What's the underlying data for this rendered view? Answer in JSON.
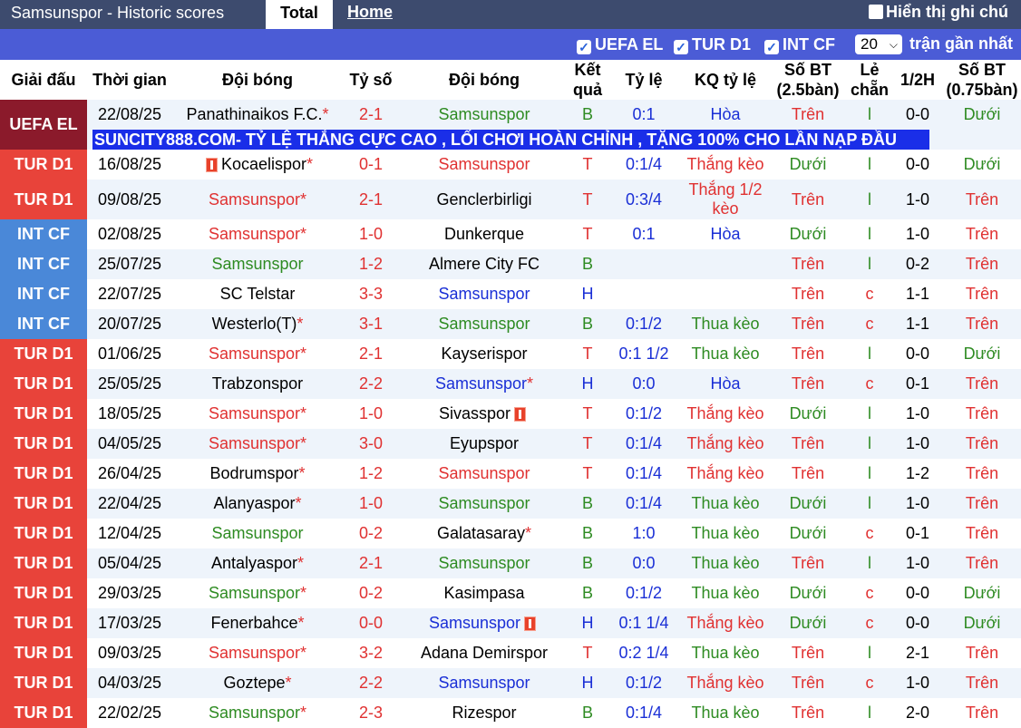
{
  "top": {
    "title": "Samsunspor - Historic scores",
    "tab_total": "Total",
    "tab_home": "Home",
    "note_label": "Hiển thị ghi chú"
  },
  "filters": {
    "items": [
      "UEFA EL",
      "TUR D1",
      "INT CF"
    ],
    "count_value": "20",
    "count_suffix": "trận gần nhất"
  },
  "columns": [
    "Giải đấu",
    "Thời gian",
    "Đội bóng",
    "Tỷ số",
    "Đội bóng",
    "Kết quả",
    "Tỷ lệ",
    "KQ tỷ lệ",
    "Số BT (2.5bàn)",
    "Lẻ chẵn",
    "1/2H",
    "Số BT (0.75bàn)"
  ],
  "banner": "SUNCITY888.COM- TỶ LỆ THẮNG CỰC CAO , LỐI CHƠI HOÀN CHỈNH , TẶNG 100% CHO LẦN NẠP ĐẦU",
  "colors": {
    "uefa": "#8b1a2b",
    "tur": "#e8433a",
    "int": "#4a88d8",
    "red": "#e03131",
    "green": "#2e8b22",
    "blue": "#1a2fd6"
  },
  "rows": [
    {
      "comp": "UEFA EL",
      "date": "22/08/25",
      "home": "Panathinaikos F.C.",
      "home_star": true,
      "home_color": "black",
      "home_card": false,
      "score": "2-1",
      "away": "Samsunspor",
      "away_star": false,
      "away_color": "green",
      "away_card": false,
      "res": "B",
      "odds": "0:1",
      "kq": "Hòa",
      "ou": "Trên",
      "oe": "l",
      "ht": "0-0",
      "ou2": "Dưới"
    },
    {
      "comp": "TUR D1",
      "date": "16/08/25",
      "home": "Kocaelispor",
      "home_star": true,
      "home_color": "black",
      "home_card": true,
      "score": "0-1",
      "away": "Samsunspor",
      "away_star": false,
      "away_color": "red",
      "away_card": false,
      "res": "T",
      "odds": "0:1/4",
      "kq": "Thắng kèo",
      "ou": "Dưới",
      "oe": "l",
      "ht": "0-0",
      "ou2": "Dưới"
    },
    {
      "comp": "TUR D1",
      "date": "09/08/25",
      "home": "Samsunspor",
      "home_star": true,
      "home_color": "red",
      "home_card": false,
      "score": "2-1",
      "away": "Genclerbirligi",
      "away_star": false,
      "away_color": "black",
      "away_card": false,
      "res": "T",
      "odds": "0:3/4",
      "kq": "Thắng 1/2 kèo",
      "ou": "Trên",
      "oe": "l",
      "ht": "1-0",
      "ou2": "Trên"
    },
    {
      "comp": "INT CF",
      "date": "02/08/25",
      "home": "Samsunspor",
      "home_star": true,
      "home_color": "red",
      "home_card": false,
      "score": "1-0",
      "away": "Dunkerque",
      "away_star": false,
      "away_color": "black",
      "away_card": false,
      "res": "T",
      "odds": "0:1",
      "kq": "Hòa",
      "ou": "Dưới",
      "oe": "l",
      "ht": "1-0",
      "ou2": "Trên"
    },
    {
      "comp": "INT CF",
      "date": "25/07/25",
      "home": "Samsunspor",
      "home_star": false,
      "home_color": "green",
      "home_card": false,
      "score": "1-2",
      "away": "Almere City FC",
      "away_star": false,
      "away_color": "black",
      "away_card": false,
      "res": "B",
      "odds": "",
      "kq": "",
      "ou": "Trên",
      "oe": "l",
      "ht": "0-2",
      "ou2": "Trên"
    },
    {
      "comp": "INT CF",
      "date": "22/07/25",
      "home": "SC Telstar",
      "home_star": false,
      "home_color": "black",
      "home_card": false,
      "score": "3-3",
      "away": "Samsunspor",
      "away_star": false,
      "away_color": "blue",
      "away_card": false,
      "res": "H",
      "odds": "",
      "kq": "",
      "ou": "Trên",
      "oe": "c",
      "ht": "1-1",
      "ou2": "Trên"
    },
    {
      "comp": "INT CF",
      "date": "20/07/25",
      "home": "Westerlo(T)",
      "home_star": true,
      "home_color": "black",
      "home_card": false,
      "score": "3-1",
      "away": "Samsunspor",
      "away_star": false,
      "away_color": "green",
      "away_card": false,
      "res": "B",
      "odds": "0:1/2",
      "kq": "Thua kèo",
      "ou": "Trên",
      "oe": "c",
      "ht": "1-1",
      "ou2": "Trên"
    },
    {
      "comp": "TUR D1",
      "date": "01/06/25",
      "home": "Samsunspor",
      "home_star": true,
      "home_color": "red",
      "home_card": false,
      "score": "2-1",
      "away": "Kayserispor",
      "away_star": false,
      "away_color": "black",
      "away_card": false,
      "res": "T",
      "odds": "0:1 1/2",
      "kq": "Thua kèo",
      "ou": "Trên",
      "oe": "l",
      "ht": "0-0",
      "ou2": "Dưới"
    },
    {
      "comp": "TUR D1",
      "date": "25/05/25",
      "home": "Trabzonspor",
      "home_star": false,
      "home_color": "black",
      "home_card": false,
      "score": "2-2",
      "away": "Samsunspor",
      "away_star": true,
      "away_color": "blue",
      "away_card": false,
      "res": "H",
      "odds": "0:0",
      "kq": "Hòa",
      "ou": "Trên",
      "oe": "c",
      "ht": "0-1",
      "ou2": "Trên"
    },
    {
      "comp": "TUR D1",
      "date": "18/05/25",
      "home": "Samsunspor",
      "home_star": true,
      "home_color": "red",
      "home_card": false,
      "score": "1-0",
      "away": "Sivasspor",
      "away_star": false,
      "away_color": "black",
      "away_card": true,
      "res": "T",
      "odds": "0:1/2",
      "kq": "Thắng kèo",
      "ou": "Dưới",
      "oe": "l",
      "ht": "1-0",
      "ou2": "Trên"
    },
    {
      "comp": "TUR D1",
      "date": "04/05/25",
      "home": "Samsunspor",
      "home_star": true,
      "home_color": "red",
      "home_card": false,
      "score": "3-0",
      "away": "Eyupspor",
      "away_star": false,
      "away_color": "black",
      "away_card": false,
      "res": "T",
      "odds": "0:1/4",
      "kq": "Thắng kèo",
      "ou": "Trên",
      "oe": "l",
      "ht": "1-0",
      "ou2": "Trên"
    },
    {
      "comp": "TUR D1",
      "date": "26/04/25",
      "home": "Bodrumspor",
      "home_star": true,
      "home_color": "black",
      "home_card": false,
      "score": "1-2",
      "away": "Samsunspor",
      "away_star": false,
      "away_color": "red",
      "away_card": false,
      "res": "T",
      "odds": "0:1/4",
      "kq": "Thắng kèo",
      "ou": "Trên",
      "oe": "l",
      "ht": "1-2",
      "ou2": "Trên"
    },
    {
      "comp": "TUR D1",
      "date": "22/04/25",
      "home": "Alanyaspor",
      "home_star": true,
      "home_color": "black",
      "home_card": false,
      "score": "1-0",
      "away": "Samsunspor",
      "away_star": false,
      "away_color": "green",
      "away_card": false,
      "res": "B",
      "odds": "0:1/4",
      "kq": "Thua kèo",
      "ou": "Dưới",
      "oe": "l",
      "ht": "1-0",
      "ou2": "Trên"
    },
    {
      "comp": "TUR D1",
      "date": "12/04/25",
      "home": "Samsunspor",
      "home_star": false,
      "home_color": "green",
      "home_card": false,
      "score": "0-2",
      "away": "Galatasaray",
      "away_star": true,
      "away_color": "black",
      "away_card": false,
      "res": "B",
      "odds": "1:0",
      "kq": "Thua kèo",
      "ou": "Dưới",
      "oe": "c",
      "ht": "0-1",
      "ou2": "Trên"
    },
    {
      "comp": "TUR D1",
      "date": "05/04/25",
      "home": "Antalyaspor",
      "home_star": true,
      "home_color": "black",
      "home_card": false,
      "score": "2-1",
      "away": "Samsunspor",
      "away_star": false,
      "away_color": "green",
      "away_card": false,
      "res": "B",
      "odds": "0:0",
      "kq": "Thua kèo",
      "ou": "Trên",
      "oe": "l",
      "ht": "1-0",
      "ou2": "Trên"
    },
    {
      "comp": "TUR D1",
      "date": "29/03/25",
      "home": "Samsunspor",
      "home_star": true,
      "home_color": "green",
      "home_card": false,
      "score": "0-2",
      "away": "Kasimpasa",
      "away_star": false,
      "away_color": "black",
      "away_card": false,
      "res": "B",
      "odds": "0:1/2",
      "kq": "Thua kèo",
      "ou": "Dưới",
      "oe": "c",
      "ht": "0-0",
      "ou2": "Dưới"
    },
    {
      "comp": "TUR D1",
      "date": "17/03/25",
      "home": "Fenerbahce",
      "home_star": true,
      "home_color": "black",
      "home_card": false,
      "score": "0-0",
      "away": "Samsunspor",
      "away_star": false,
      "away_color": "blue",
      "away_card": true,
      "res": "H",
      "odds": "0:1 1/4",
      "kq": "Thắng kèo",
      "ou": "Dưới",
      "oe": "c",
      "ht": "0-0",
      "ou2": "Dưới"
    },
    {
      "comp": "TUR D1",
      "date": "09/03/25",
      "home": "Samsunspor",
      "home_star": true,
      "home_color": "red",
      "home_card": false,
      "score": "3-2",
      "away": "Adana Demirspor",
      "away_star": false,
      "away_color": "black",
      "away_card": false,
      "res": "T",
      "odds": "0:2 1/4",
      "kq": "Thua kèo",
      "ou": "Trên",
      "oe": "l",
      "ht": "2-1",
      "ou2": "Trên"
    },
    {
      "comp": "TUR D1",
      "date": "04/03/25",
      "home": "Goztepe",
      "home_star": true,
      "home_color": "black",
      "home_card": false,
      "score": "2-2",
      "away": "Samsunspor",
      "away_star": false,
      "away_color": "blue",
      "away_card": false,
      "res": "H",
      "odds": "0:1/2",
      "kq": "Thắng kèo",
      "ou": "Trên",
      "oe": "c",
      "ht": "1-0",
      "ou2": "Trên"
    },
    {
      "comp": "TUR D1",
      "date": "22/02/25",
      "home": "Samsunspor",
      "home_star": true,
      "home_color": "green",
      "home_card": false,
      "score": "2-3",
      "away": "Rizespor",
      "away_star": false,
      "away_color": "black",
      "away_card": false,
      "res": "B",
      "odds": "0:1/4",
      "kq": "Thua kèo",
      "ou": "Trên",
      "oe": "l",
      "ht": "2-0",
      "ou2": "Trên"
    }
  ]
}
